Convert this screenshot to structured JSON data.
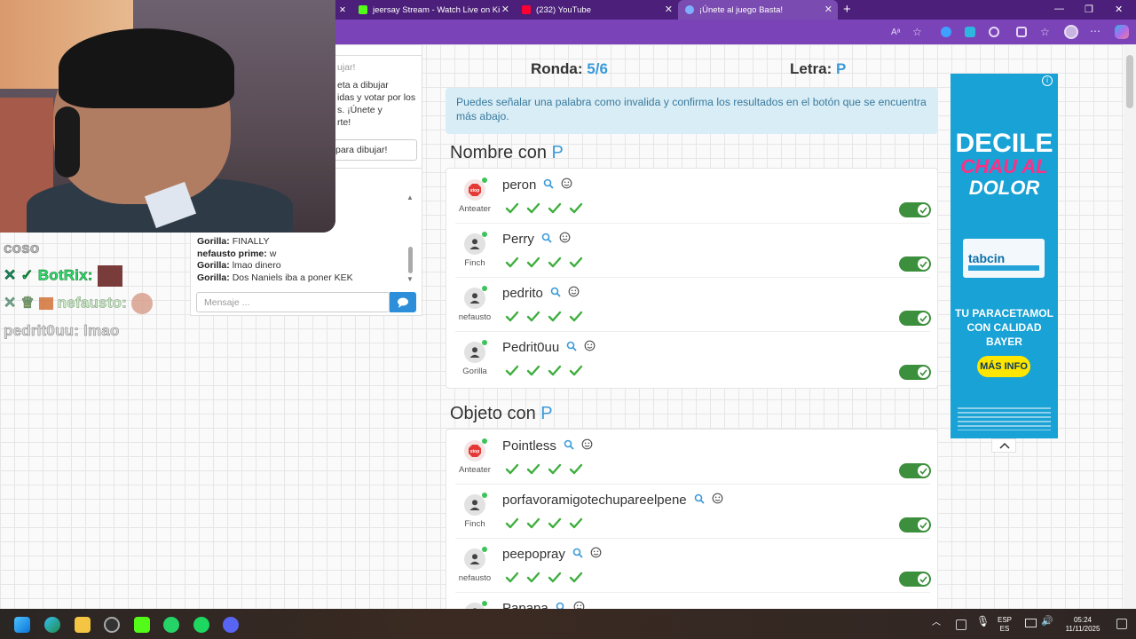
{
  "browser": {
    "tabs": [
      {
        "title": "jeersay Stream - Watch Live on Ki",
        "color": "#53fc18"
      },
      {
        "title": "(232) YouTube",
        "color": "#ff0033"
      },
      {
        "title": "¡Únete al juego Basta!",
        "color": "#7fb0ff"
      }
    ],
    "new_tab": "+"
  },
  "game": {
    "ronda_label": "Ronda:",
    "ronda_value": "5/6",
    "letra_label": "Letra:",
    "letra_value": "P",
    "info": "Puedes señalar una palabra como invalida y confirma los resultados en el botón que se encuentra más abajo.",
    "sections": [
      {
        "title_prefix": "Nombre con",
        "letter": "P",
        "rows": [
          {
            "word": "peron",
            "player": "Anteater",
            "avatar": "stop",
            "valid": true
          },
          {
            "word": "Perry",
            "player": "Finch",
            "avatar": "user",
            "valid": true
          },
          {
            "word": "pedrito",
            "player": "nefausto",
            "avatar": "user",
            "valid": true
          },
          {
            "word": "Pedrit0uu",
            "player": "Gorilla",
            "avatar": "user",
            "valid": true
          }
        ]
      },
      {
        "title_prefix": "Objeto con",
        "letter": "P",
        "rows": [
          {
            "word": "Pointless",
            "player": "Anteater",
            "avatar": "stop",
            "valid": true
          },
          {
            "word": "porfavoramigotechupareelpene",
            "player": "Finch",
            "avatar": "user",
            "valid": true
          },
          {
            "word": "peepopray",
            "player": "nefausto",
            "avatar": "user",
            "valid": true
          },
          {
            "word": "Papapa",
            "player": "",
            "avatar": "user",
            "valid": true
          }
        ]
      }
    ]
  },
  "chat": {
    "join_header": "ujar!",
    "join_text": "eta a dibujar\nidas y votar por los\ns. ¡Únete y\nrte!",
    "join_input": "para dibujar!",
    "messages": [
      {
        "user": "Gorilla:",
        "text": "FINALLY"
      },
      {
        "user": "nefausto prime:",
        "text": "w"
      },
      {
        "user": "Gorilla:",
        "text": "lmao dinero"
      },
      {
        "user": "Gorilla:",
        "text": "Dos Naniels iba a poner KEK"
      }
    ],
    "placeholder": "Mensaje ..."
  },
  "overlay": {
    "line1": "coso",
    "line2_user": "BotRix:",
    "line3_user": "nefausto:",
    "line4_user": "pedrit0uu:",
    "line4_text": "lmao"
  },
  "ad": {
    "line1": "DECILE",
    "line2": "CHAU AL",
    "line3": "DOLOR",
    "brand": "tabcin",
    "tagline": "TU PARACETAMOL CON CALIDAD BAYER",
    "cta": "MÁS INFO"
  },
  "system": {
    "lang1": "ESP",
    "lang2": "ES",
    "time": "05:24",
    "date": "11/11/2025"
  },
  "colors": {
    "accent": "#3a9ad9",
    "toggle_on": "#3c8f3c",
    "check": "#3fae3f",
    "tab_bar": "#4b1f7a"
  }
}
